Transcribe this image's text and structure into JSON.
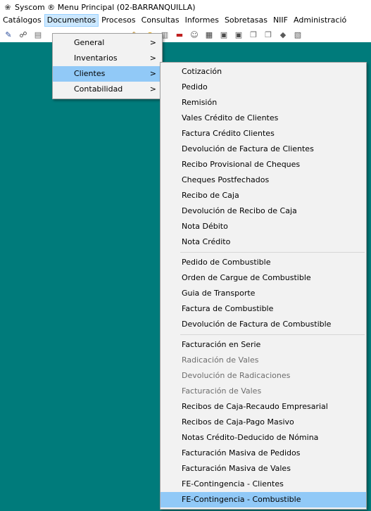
{
  "window": {
    "title": "Syscom ® Menu Principal (02-BARRANQUILLA)",
    "icon": "app-icon"
  },
  "menubar": {
    "items": [
      {
        "label": "Catálogos"
      },
      {
        "label": "Documentos"
      },
      {
        "label": "Procesos"
      },
      {
        "label": "Consultas"
      },
      {
        "label": "Informes"
      },
      {
        "label": "Sobretasas"
      },
      {
        "label": "NIIF"
      },
      {
        "label": "Administració"
      }
    ],
    "active_index": 1
  },
  "toolbar": {
    "icons": [
      "tool-icon",
      "network-icon",
      "document-icon",
      "tool-icon",
      "coin-icon",
      "book-icon",
      "truck-icon",
      "people-icon",
      "file-icon",
      "report-icon",
      "report-icon",
      "copy-icon",
      "copy-icon",
      "tag-icon",
      "chart-icon"
    ]
  },
  "documentos_menu": {
    "items": [
      {
        "label": "General",
        "submenu_arrow": ">"
      },
      {
        "label": "Inventarios",
        "submenu_arrow": ">"
      },
      {
        "label": "Clientes",
        "submenu_arrow": ">"
      },
      {
        "label": "Contabilidad",
        "submenu_arrow": ">"
      }
    ],
    "highlighted": "Clientes"
  },
  "clientes_menu": {
    "groups": [
      [
        {
          "label": "Cotización",
          "enabled": true
        },
        {
          "label": "Pedido",
          "enabled": true
        },
        {
          "label": "Remisión",
          "enabled": true
        },
        {
          "label": "Vales Crédito de Clientes",
          "enabled": true
        },
        {
          "label": "Factura Crédito Clientes",
          "enabled": true
        },
        {
          "label": "Devolución de Factura de Clientes",
          "enabled": true
        },
        {
          "label": "Recibo Provisional de Cheques",
          "enabled": true
        },
        {
          "label": "Cheques Postfechados",
          "enabled": true
        },
        {
          "label": "Recibo de Caja",
          "enabled": true
        },
        {
          "label": "Devolución de Recibo de Caja",
          "enabled": true
        },
        {
          "label": "Nota Débito",
          "enabled": true
        },
        {
          "label": "Nota Crédito",
          "enabled": true
        }
      ],
      [
        {
          "label": "Pedido de Combustible",
          "enabled": true
        },
        {
          "label": "Orden de Cargue de Combustible",
          "enabled": true
        },
        {
          "label": "Guia de Transporte",
          "enabled": true
        },
        {
          "label": "Factura de Combustible",
          "enabled": true
        },
        {
          "label": "Devolución de Factura de Combustible",
          "enabled": true
        }
      ],
      [
        {
          "label": "Facturación en Serie",
          "enabled": true
        },
        {
          "label": "Radicación de Vales",
          "enabled": false
        },
        {
          "label": "Devolución de Radicaciones",
          "enabled": false
        },
        {
          "label": "Facturación de Vales",
          "enabled": false
        },
        {
          "label": "Recibos de Caja-Recaudo Empresarial",
          "enabled": true
        },
        {
          "label": "Recibos de Caja-Pago Masivo",
          "enabled": true
        },
        {
          "label": "Notas Crédito-Deducido de Nómina",
          "enabled": true
        },
        {
          "label": "Facturación Masiva de Pedidos",
          "enabled": true
        },
        {
          "label": "Facturación Masiva de Vales",
          "enabled": true
        },
        {
          "label": "FE-Contingencia - Clientes",
          "enabled": true
        },
        {
          "label": "FE-Contingencia - Combustible",
          "enabled": true
        }
      ]
    ],
    "highlighted": "FE-Contingencia - Combustible"
  },
  "colors": {
    "workspace": "#007b7b",
    "menu_bg": "#f2f2f2",
    "highlight": "#91c9f7",
    "menubar_active": "#cce8ff",
    "disabled_text": "#6d6d6d"
  }
}
